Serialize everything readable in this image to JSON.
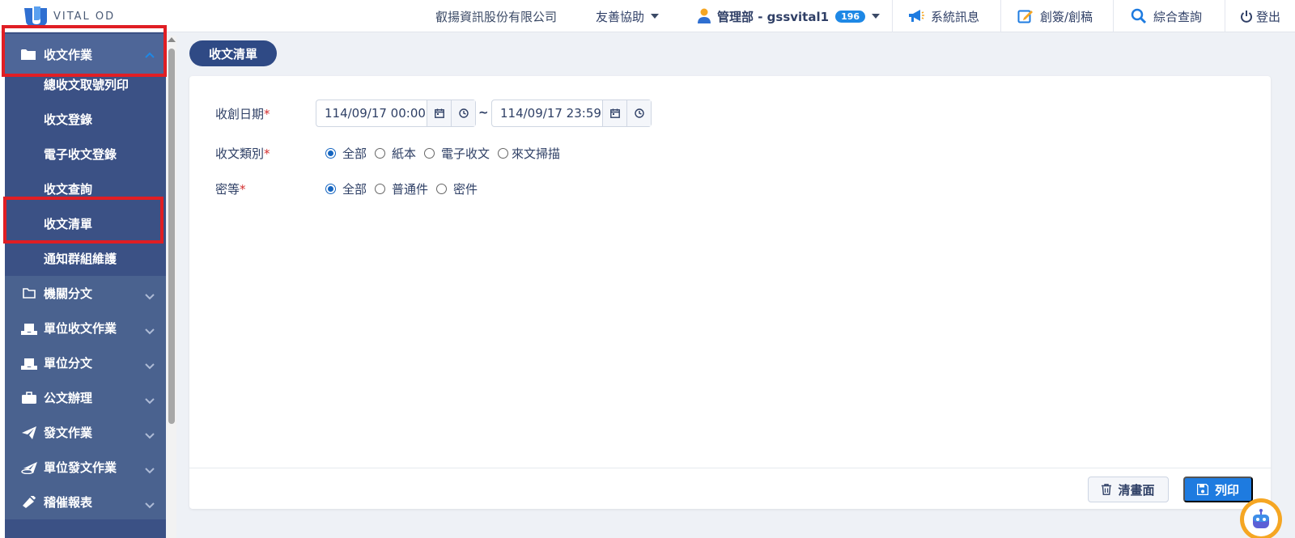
{
  "header": {
    "logo_text": "VITAL OD",
    "company": "叡揚資訊股份有限公司",
    "help": "友善協助",
    "user": "管理部 - gssvital1",
    "user_badge": "196",
    "system_msg": "系統訊息",
    "draft": "創簽/創稿",
    "search": "綜合查詢",
    "logout": "登出"
  },
  "sidebar": {
    "top": "收文作業",
    "sub_items": [
      "總收文取號列印",
      "收文登錄",
      "電子收文登錄",
      "收文查詢",
      "收文清單",
      "通知群組維護"
    ],
    "groups": [
      "機關分文",
      "單位收文作業",
      "單位分文",
      "公文辦理",
      "發文作業",
      "單位發文作業",
      "稽催報表"
    ]
  },
  "page": {
    "tab_label": "收文清單"
  },
  "form": {
    "date_label": "收創日期",
    "required_mark": "*",
    "date_from": "114/09/17 00:00",
    "date_to": "114/09/17 23:59",
    "tilde": "~",
    "type_label": "收文類別",
    "type_options": [
      "全部",
      "紙本",
      "電子收文",
      "來文掃描"
    ],
    "secret_label": "密等",
    "secret_options": [
      "全部",
      "普通件",
      "密件"
    ]
  },
  "footer": {
    "clear_label": "清畫面",
    "print_label": "列印"
  },
  "colors": {
    "sidebar_bg": "#3b5185",
    "accent": "#1e7be0",
    "highlight": "#e01e24"
  }
}
